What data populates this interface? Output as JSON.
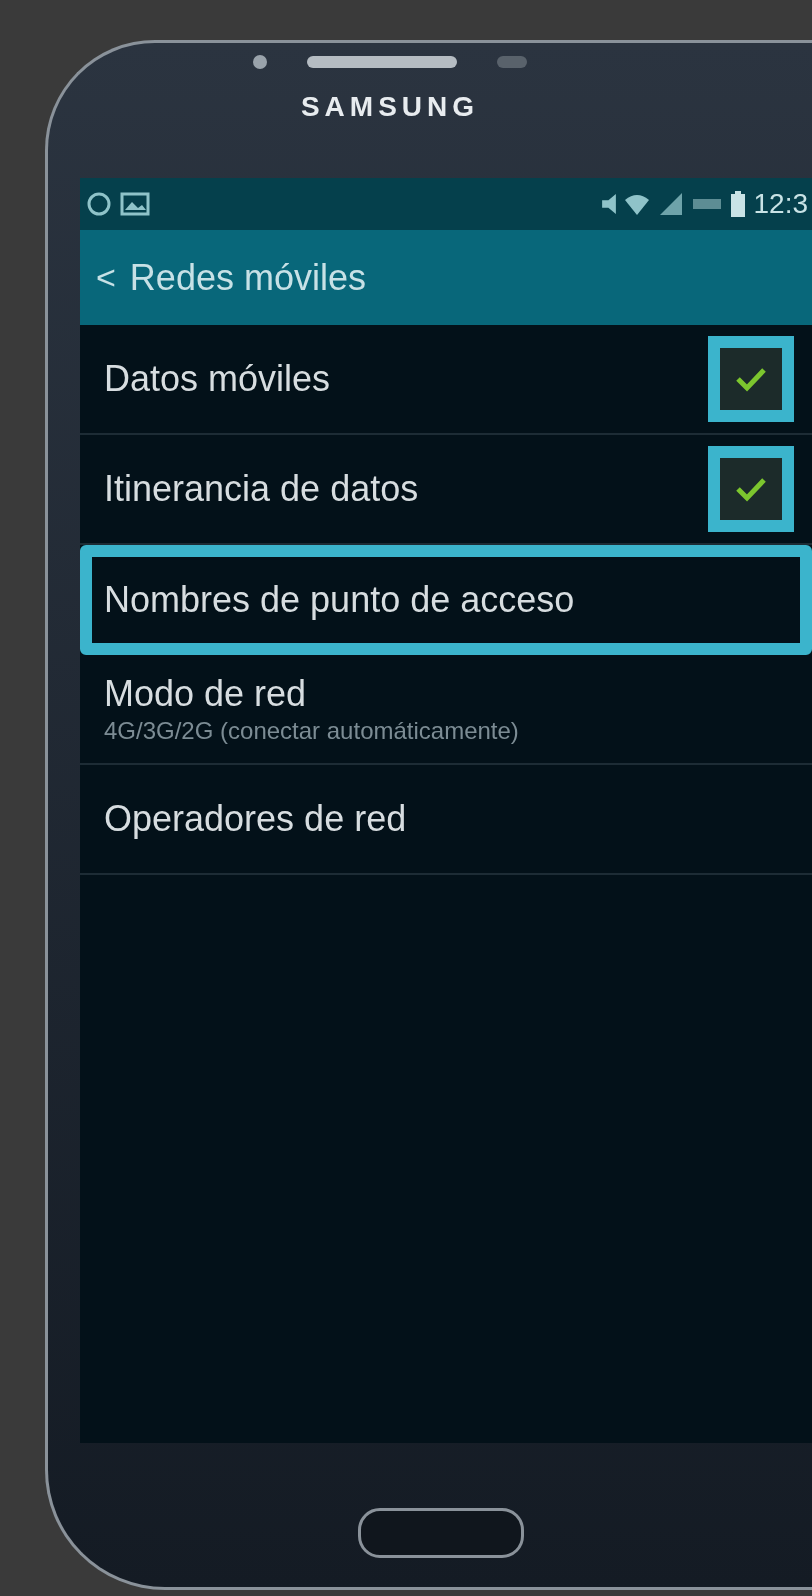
{
  "device": {
    "brand": "SAMSUNG"
  },
  "status_bar": {
    "time": "12:3"
  },
  "action_bar": {
    "back": "<",
    "title": "Redes móviles"
  },
  "items": [
    {
      "kind": "checkbox",
      "label": "Datos móviles",
      "checked": true,
      "highlighted": true
    },
    {
      "kind": "checkbox",
      "label": "Itinerancia de datos",
      "checked": true,
      "highlighted": true
    },
    {
      "kind": "link",
      "label": "Nombres de punto de acceso",
      "highlighted": true
    },
    {
      "kind": "link",
      "label": "Modo de red",
      "summary": "4G/3G/2G (conectar automáticamente)",
      "highlighted": false
    },
    {
      "kind": "link",
      "label": "Operadores de red",
      "highlighted": false
    }
  ]
}
